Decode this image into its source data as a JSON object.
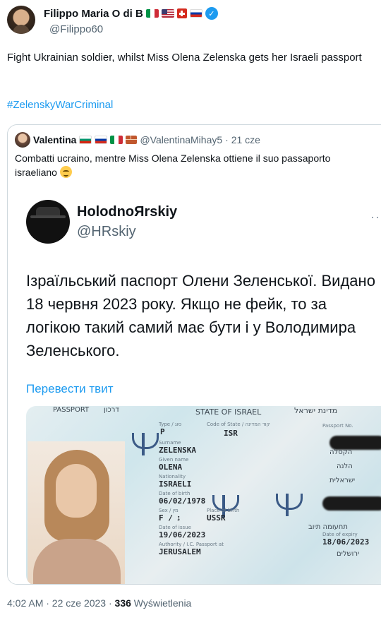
{
  "tweet": {
    "author_name": "Filippo Maria O di B",
    "handle": "@Filippo60",
    "text": "Fight Ukrainian soldier, whilst Miss Olena Zelenska gets her Israeli passport",
    "hashtag": "#ZelenskyWarCriminal",
    "timestamp": "4:02 AM · 22 cze 2023 · ",
    "views_count": "336",
    "views_label": " Wyświetlenia",
    "verified_glyph": "✓"
  },
  "quoted": {
    "author_name": "Valentina",
    "handle": "@ValentinaMihay5",
    "time": "· 21 cze",
    "text": "Combatti  ucraino, mentre Miss Olena Zelenska ottiene il suo passaporto israeliano"
  },
  "screenshot": {
    "name": "HolodnoЯrskiy",
    "handle": "@HRskiy",
    "dots": "··",
    "text": "Ізраїльський паспорт Олени Зеленської. Видано 18 червня 2023 року. Якщо не фейк, то за логікою такий самий має бути і у Володимира Зеленського.",
    "translate_link": "Перевести твит"
  },
  "passport": {
    "passport_label": "PASSPORT",
    "passport_hebrew": "דרכון",
    "state_label": "STATE OF ISRAEL",
    "state_hebrew": "מדינת ישראל",
    "type_label": "Type / סוג",
    "type_value": "P",
    "code_label": "Code of State / קוד המדינה",
    "code_value": "ISR",
    "passport_no_label": "Passport No.",
    "surname_label": "Surname",
    "surname_value": "ZELENSKA",
    "given_label": "Given name",
    "given_value": "OLENA",
    "nationality_label": "Nationality",
    "nationality_value": "ISRAELI",
    "dob_label": "Date of birth",
    "dob_value": "06/02/1978",
    "sex_label": "Sex / מין",
    "sex_value": "F / נ",
    "pob_label": "Place of birth",
    "pob_value": "USSR",
    "issue_label": "Date of issue",
    "issue_value": "19/06/2023",
    "expiry_label": "Date of expiry",
    "expiry_value": "18/06/2023",
    "authority_label": "Authority / I.C. Passport at",
    "authority_value": "JERUSALEM",
    "heb_surname": "הקסלה",
    "heb_given": "הלנה",
    "heb_nationality": "ישראלית",
    "heb_issue": "תחעומה תיוב",
    "heb_city": "ירושלים"
  }
}
